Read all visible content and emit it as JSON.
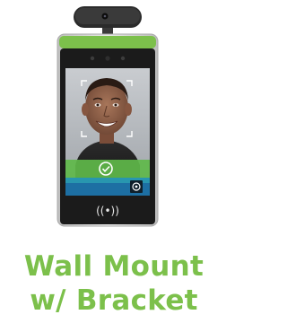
{
  "product": {
    "colors": {
      "accent": "#7cc04b",
      "bezel": "#1b1b1b",
      "frame": "#d9d9d9",
      "camera_bar": "#2a2a2a",
      "status_green": "#5fb84a",
      "status_blue": "#1d6fa3",
      "status_teal": "#2a9ab0"
    },
    "nfc_label": "((•))"
  },
  "caption": {
    "line1": "Wall Mount",
    "line2": "w/ Bracket",
    "color": "#7cc04b"
  }
}
